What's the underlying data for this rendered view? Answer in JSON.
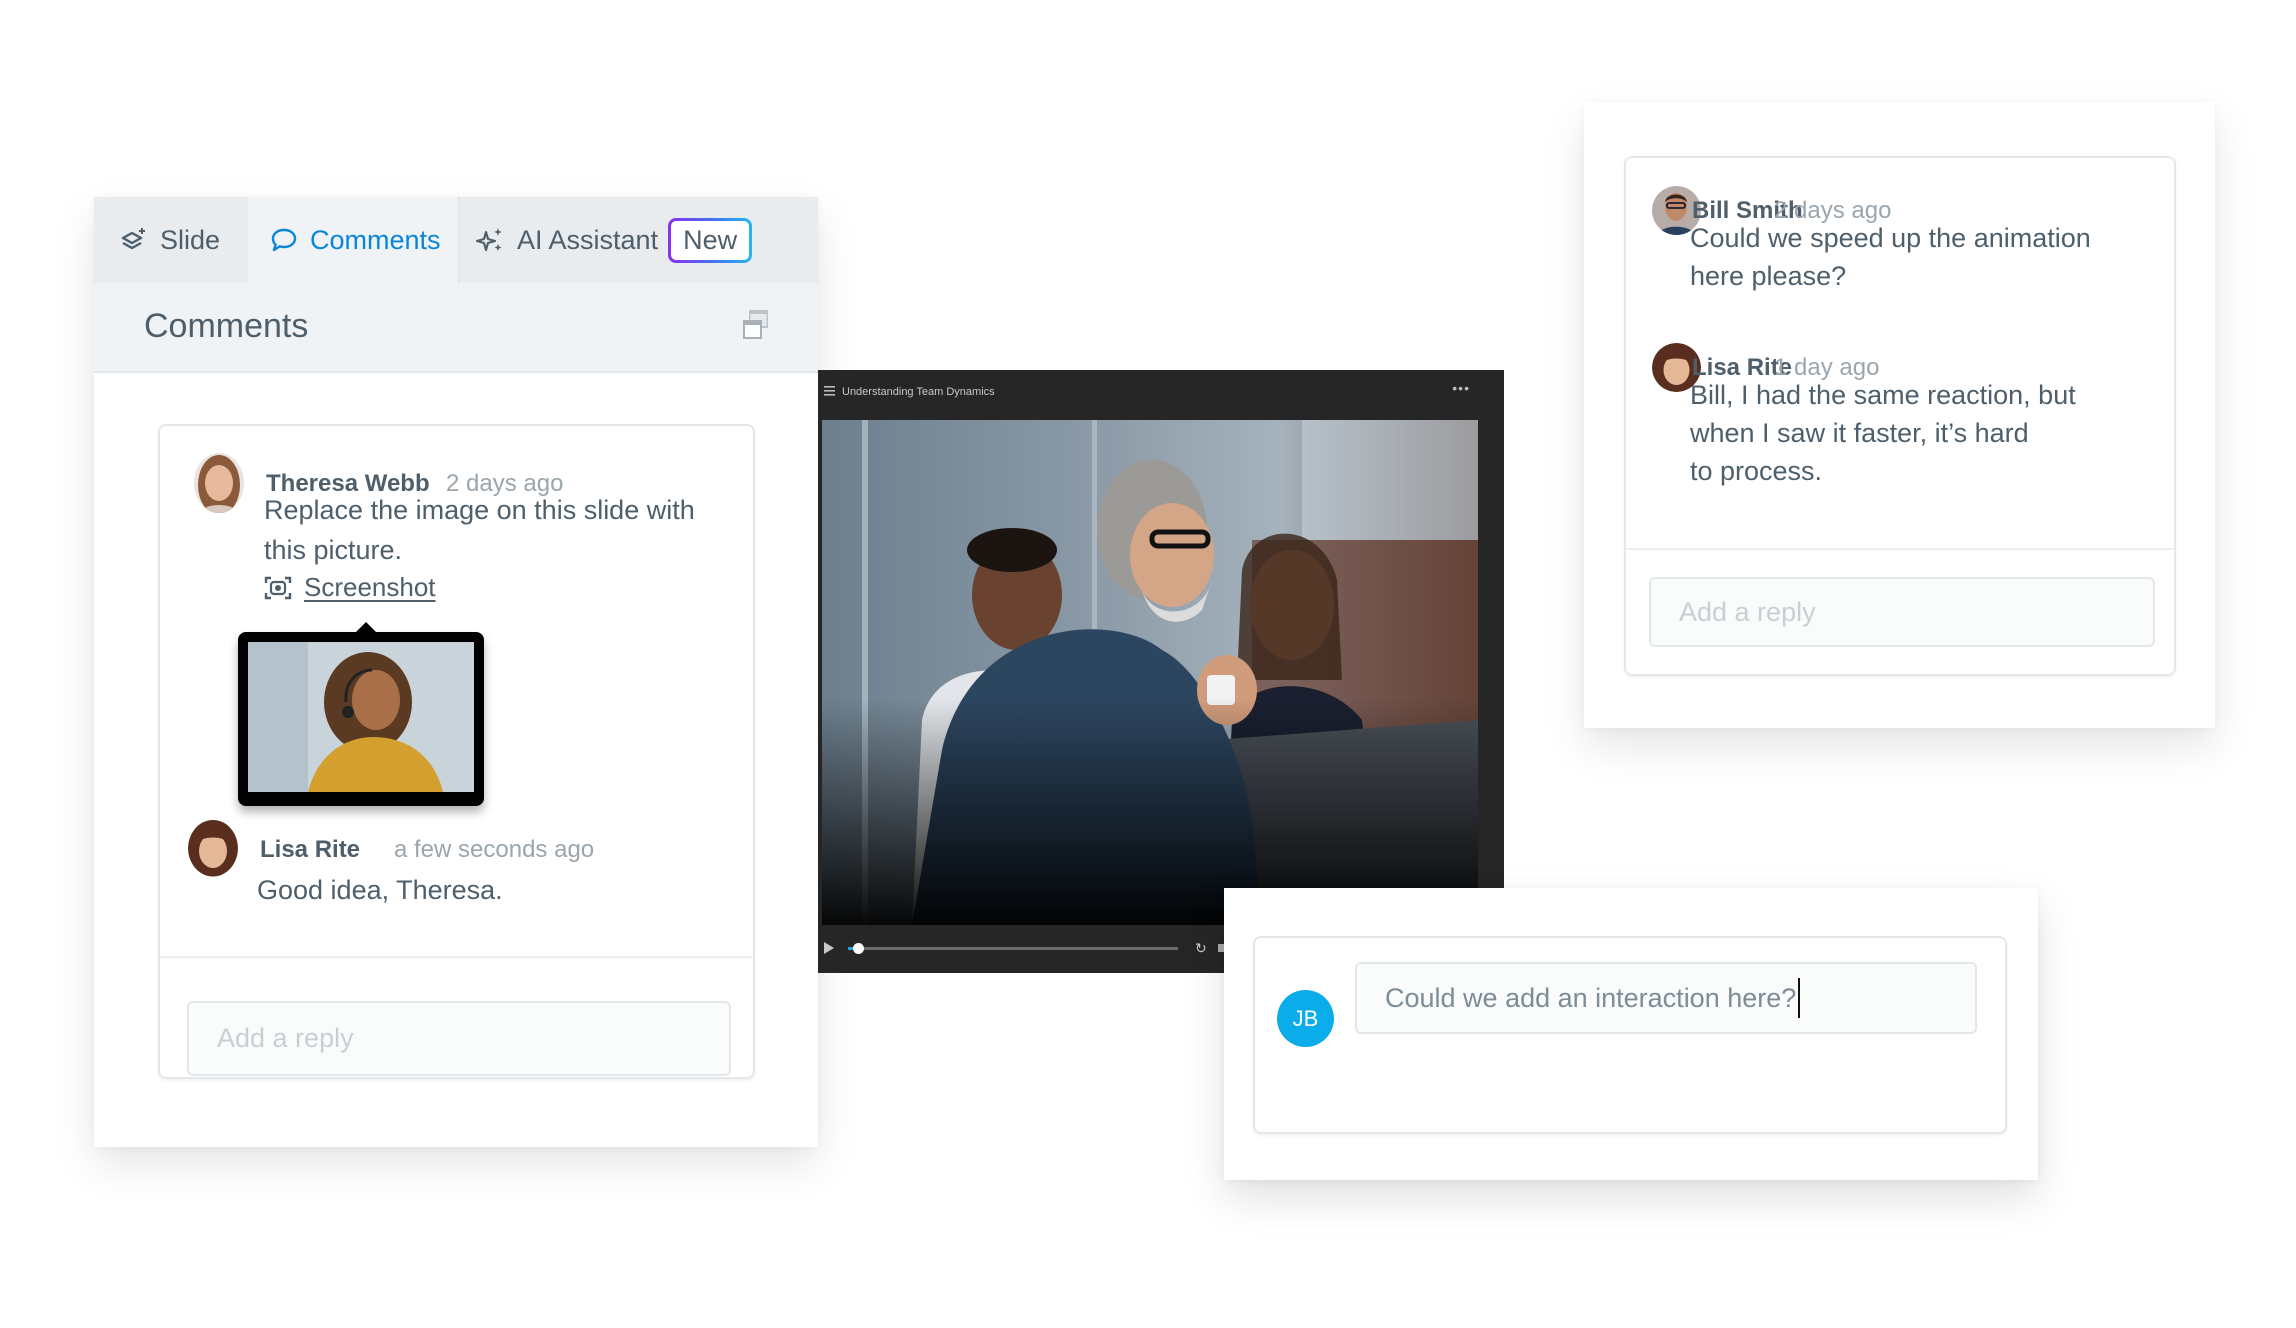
{
  "left_panel": {
    "tabs": [
      {
        "label": "Slide",
        "icon": "layers-plus-icon",
        "active": false
      },
      {
        "label": "Comments",
        "icon": "speech-bubble-icon",
        "active": true
      },
      {
        "label": "AI Assistant",
        "icon": "sparkles-icon",
        "active": false,
        "badge": "New"
      }
    ],
    "title": "Comments",
    "popout_icon": "popout-window-icon",
    "thread": {
      "comments": [
        {
          "author": "Theresa Webb",
          "time": "2 days ago",
          "text": "Replace the image on this slide with this picture.",
          "attachment": {
            "label": "Screenshot",
            "icon": "screenshot-icon"
          }
        },
        {
          "author": "Lisa Rite",
          "time": "a few seconds ago",
          "text": "Good idea, Theresa."
        }
      ],
      "reply_placeholder": "Add a reply"
    }
  },
  "video": {
    "title": "Understanding Team Dynamics",
    "menu_icon": "hamburger-icon",
    "more_icon": "more-horizontal-icon",
    "progress": 0.03,
    "controls": [
      "play-icon",
      "replay-icon",
      "volume-icon"
    ]
  },
  "right_panel": {
    "comments": [
      {
        "author": "Bill Smith",
        "time": "2 days ago",
        "text_lines": [
          "Could we speed up the animation",
          "here please?"
        ]
      },
      {
        "author": "Lisa Rite",
        "time": "1 day ago",
        "text_lines": [
          "Bill, I had the same reaction, but",
          "when I saw it faster, it’s hard",
          "to process."
        ]
      }
    ],
    "reply_placeholder": "Add a reply"
  },
  "new_comment": {
    "avatar_initials": "JB",
    "avatar_color": "#0aade9",
    "input_value": "Could we add an interaction here?"
  },
  "colors": {
    "accent_blue": "#0a85d9",
    "text": "#4e5f6b",
    "muted": "#9aa5ad"
  }
}
